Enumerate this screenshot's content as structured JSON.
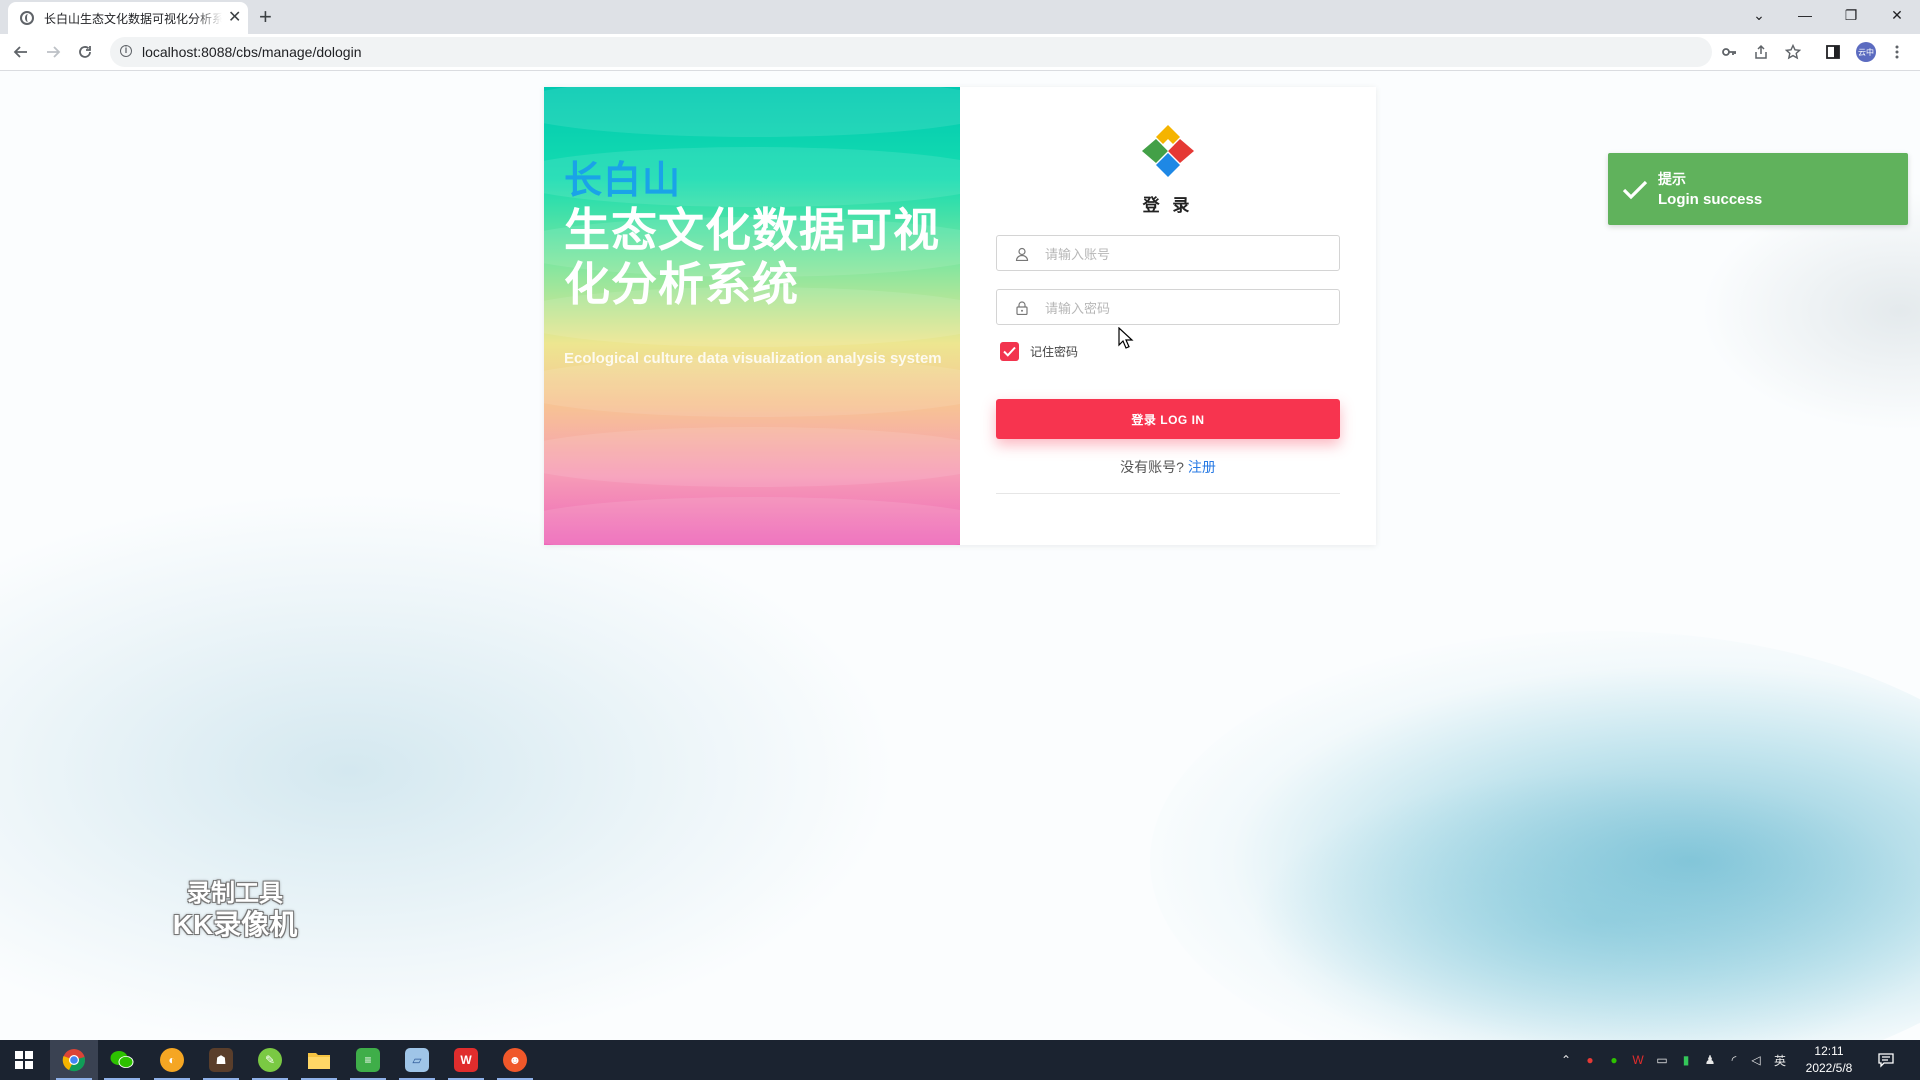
{
  "browser": {
    "tab_title": "长白山生态文化数据可视化分析系统",
    "url": "localhost:8088/cbs/manage/dologin",
    "profile_label": "云中",
    "tab_close": "✕",
    "new_tab": "+",
    "window_controls": [
      "⌄",
      "—",
      "❐",
      "✕"
    ]
  },
  "hero": {
    "title_small": "长白山",
    "title_big": "生态文化数据可视化分析系统",
    "subtitle": "Ecological culture data visualization analysis system"
  },
  "login": {
    "title": "登 录",
    "username_placeholder": "请输入账号",
    "password_placeholder": "请输入密码",
    "remember_label": "记住密码",
    "remember_checked": true,
    "button_label": "登录 LOG IN",
    "no_account_text": "没有账号?",
    "register_link": "注册"
  },
  "toast": {
    "title": "提示",
    "message": "Login success",
    "color": "#60b25c"
  },
  "watermark": {
    "line1": "录制工具",
    "line2": "KK录像机"
  },
  "taskbar": {
    "time": "12:11",
    "date": "2022/5/8",
    "ime": "英",
    "apps": [
      "start-icon",
      "chrome-icon",
      "wechat-icon",
      "audio-app-icon",
      "game-app-icon",
      "green-app-icon",
      "file-explorer-icon",
      "notepad-icon",
      "paper-app-icon",
      "wps-icon",
      "red-app-icon"
    ]
  },
  "colors": {
    "accent": "#f7344f",
    "link": "#2a7be4",
    "hero_title_small": "#1aa3e8"
  }
}
